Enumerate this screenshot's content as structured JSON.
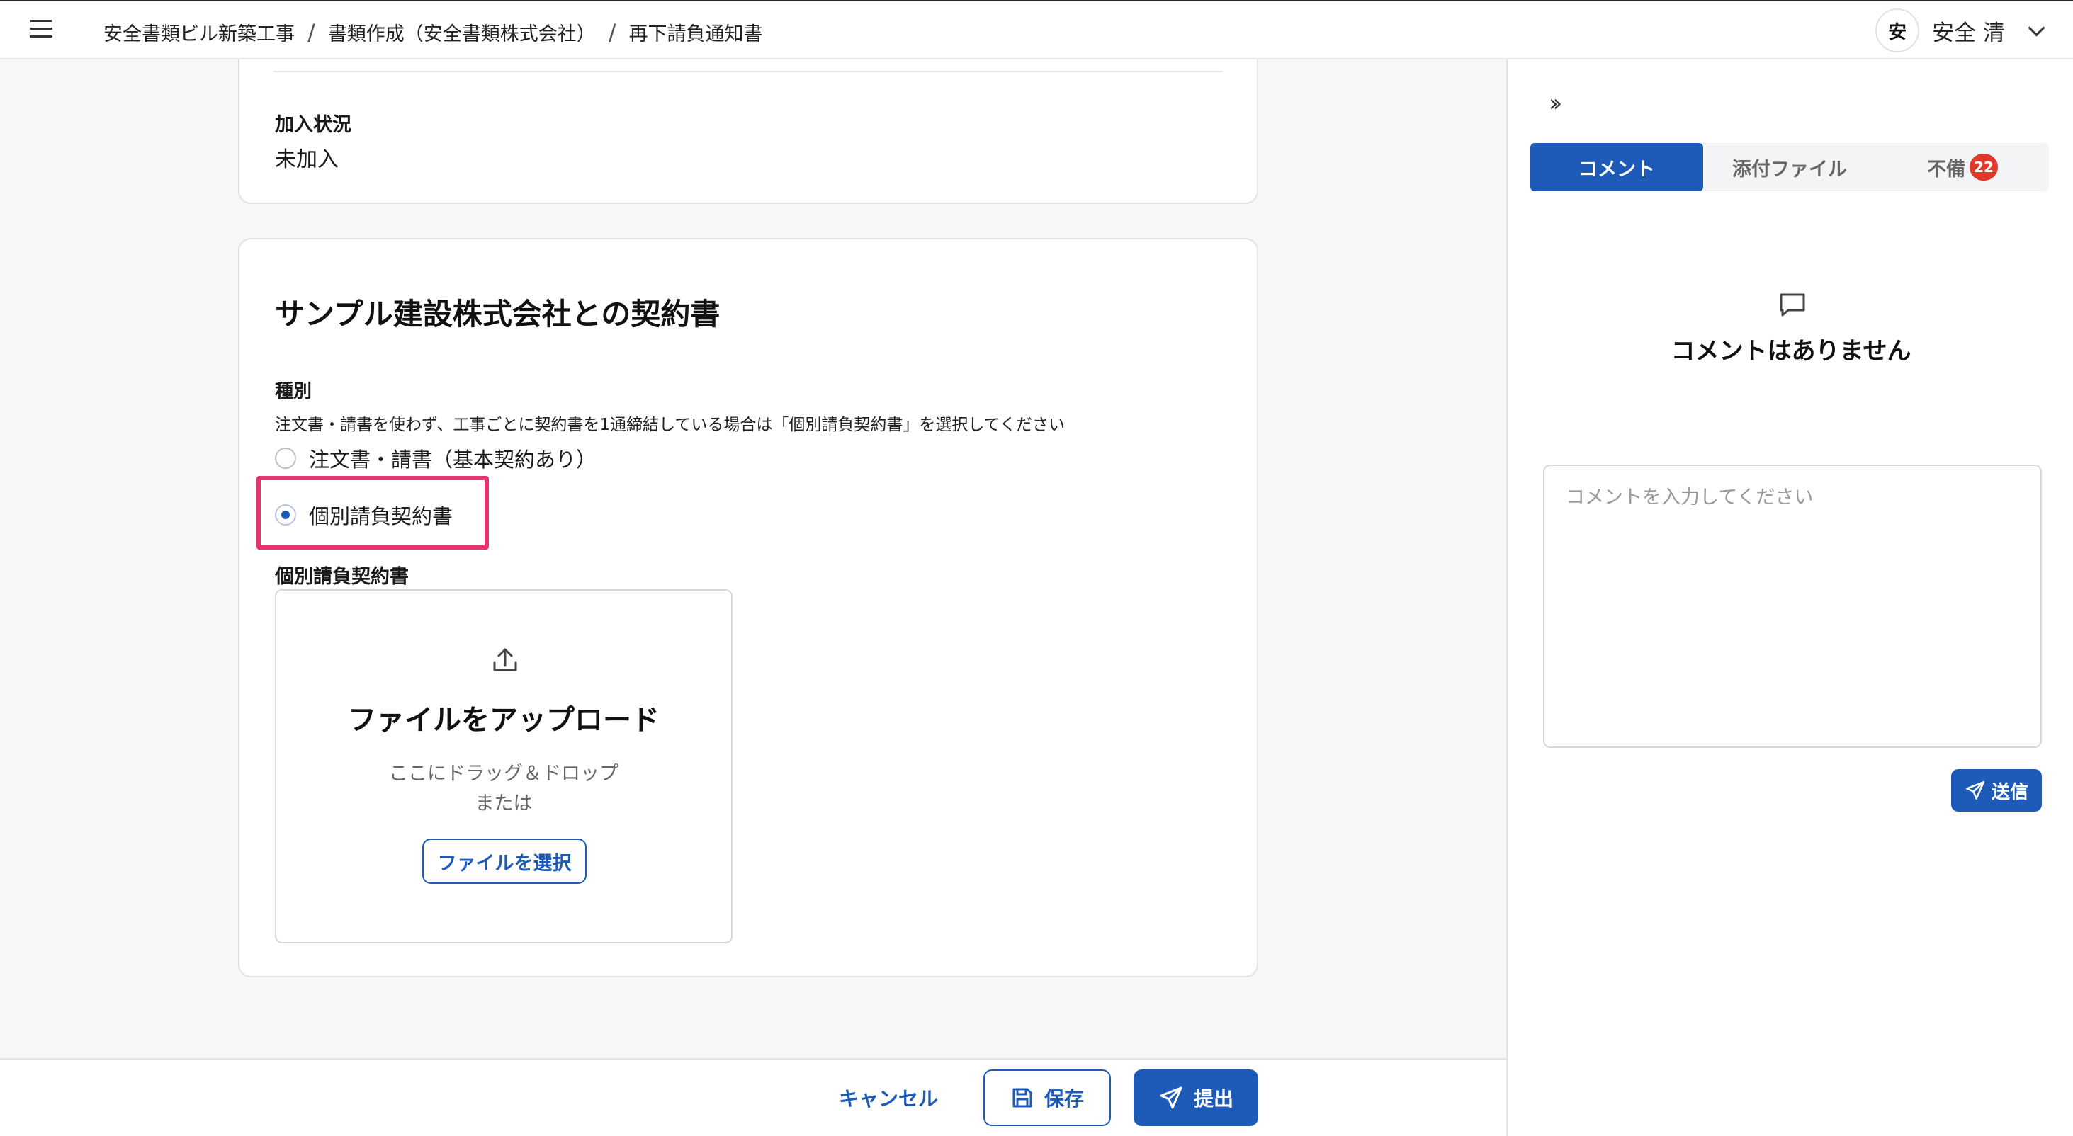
{
  "header": {
    "breadcrumb": [
      "安全書類ビル新築工事",
      "書類作成（安全書類株式会社）",
      "再下請負通知書"
    ],
    "separator": "/",
    "avatar_char": "安",
    "user_name": "安全 清"
  },
  "section_insurance": {
    "label": "加入状況",
    "value": "未加入"
  },
  "contract": {
    "title": "サンプル建設株式会社との契約書",
    "type_label": "種別",
    "help_text": "注文書・請書を使わず、工事ごとに契約書を1通締結している場合は「個別請負契約書」を選択してください",
    "options": [
      {
        "label": "注文書・請書（基本契約あり）",
        "checked": false
      },
      {
        "label": "個別請負契約書",
        "checked": true
      }
    ],
    "upload_label": "個別請負契約書",
    "upload": {
      "title": "ファイルをアップロード",
      "drag_text": "ここにドラッグ＆ドロップ",
      "or_text": "または",
      "select_button": "ファイルを選択"
    }
  },
  "footer": {
    "cancel": "キャンセル",
    "save": "保存",
    "submit": "提出"
  },
  "panel": {
    "collapse_icon": "double-chevron-right-icon",
    "tabs": [
      {
        "label": "コメント",
        "active": true
      },
      {
        "label": "添付ファイル",
        "active": false
      },
      {
        "label": "不備",
        "active": false,
        "badge": "22"
      }
    ],
    "empty_text": "コメントはありません",
    "comment_placeholder": "コメントを入力してください",
    "send_button": "送信"
  },
  "colors": {
    "primary": "#1e5bb8",
    "highlight": "#e8336f",
    "badge": "#e0392b"
  }
}
